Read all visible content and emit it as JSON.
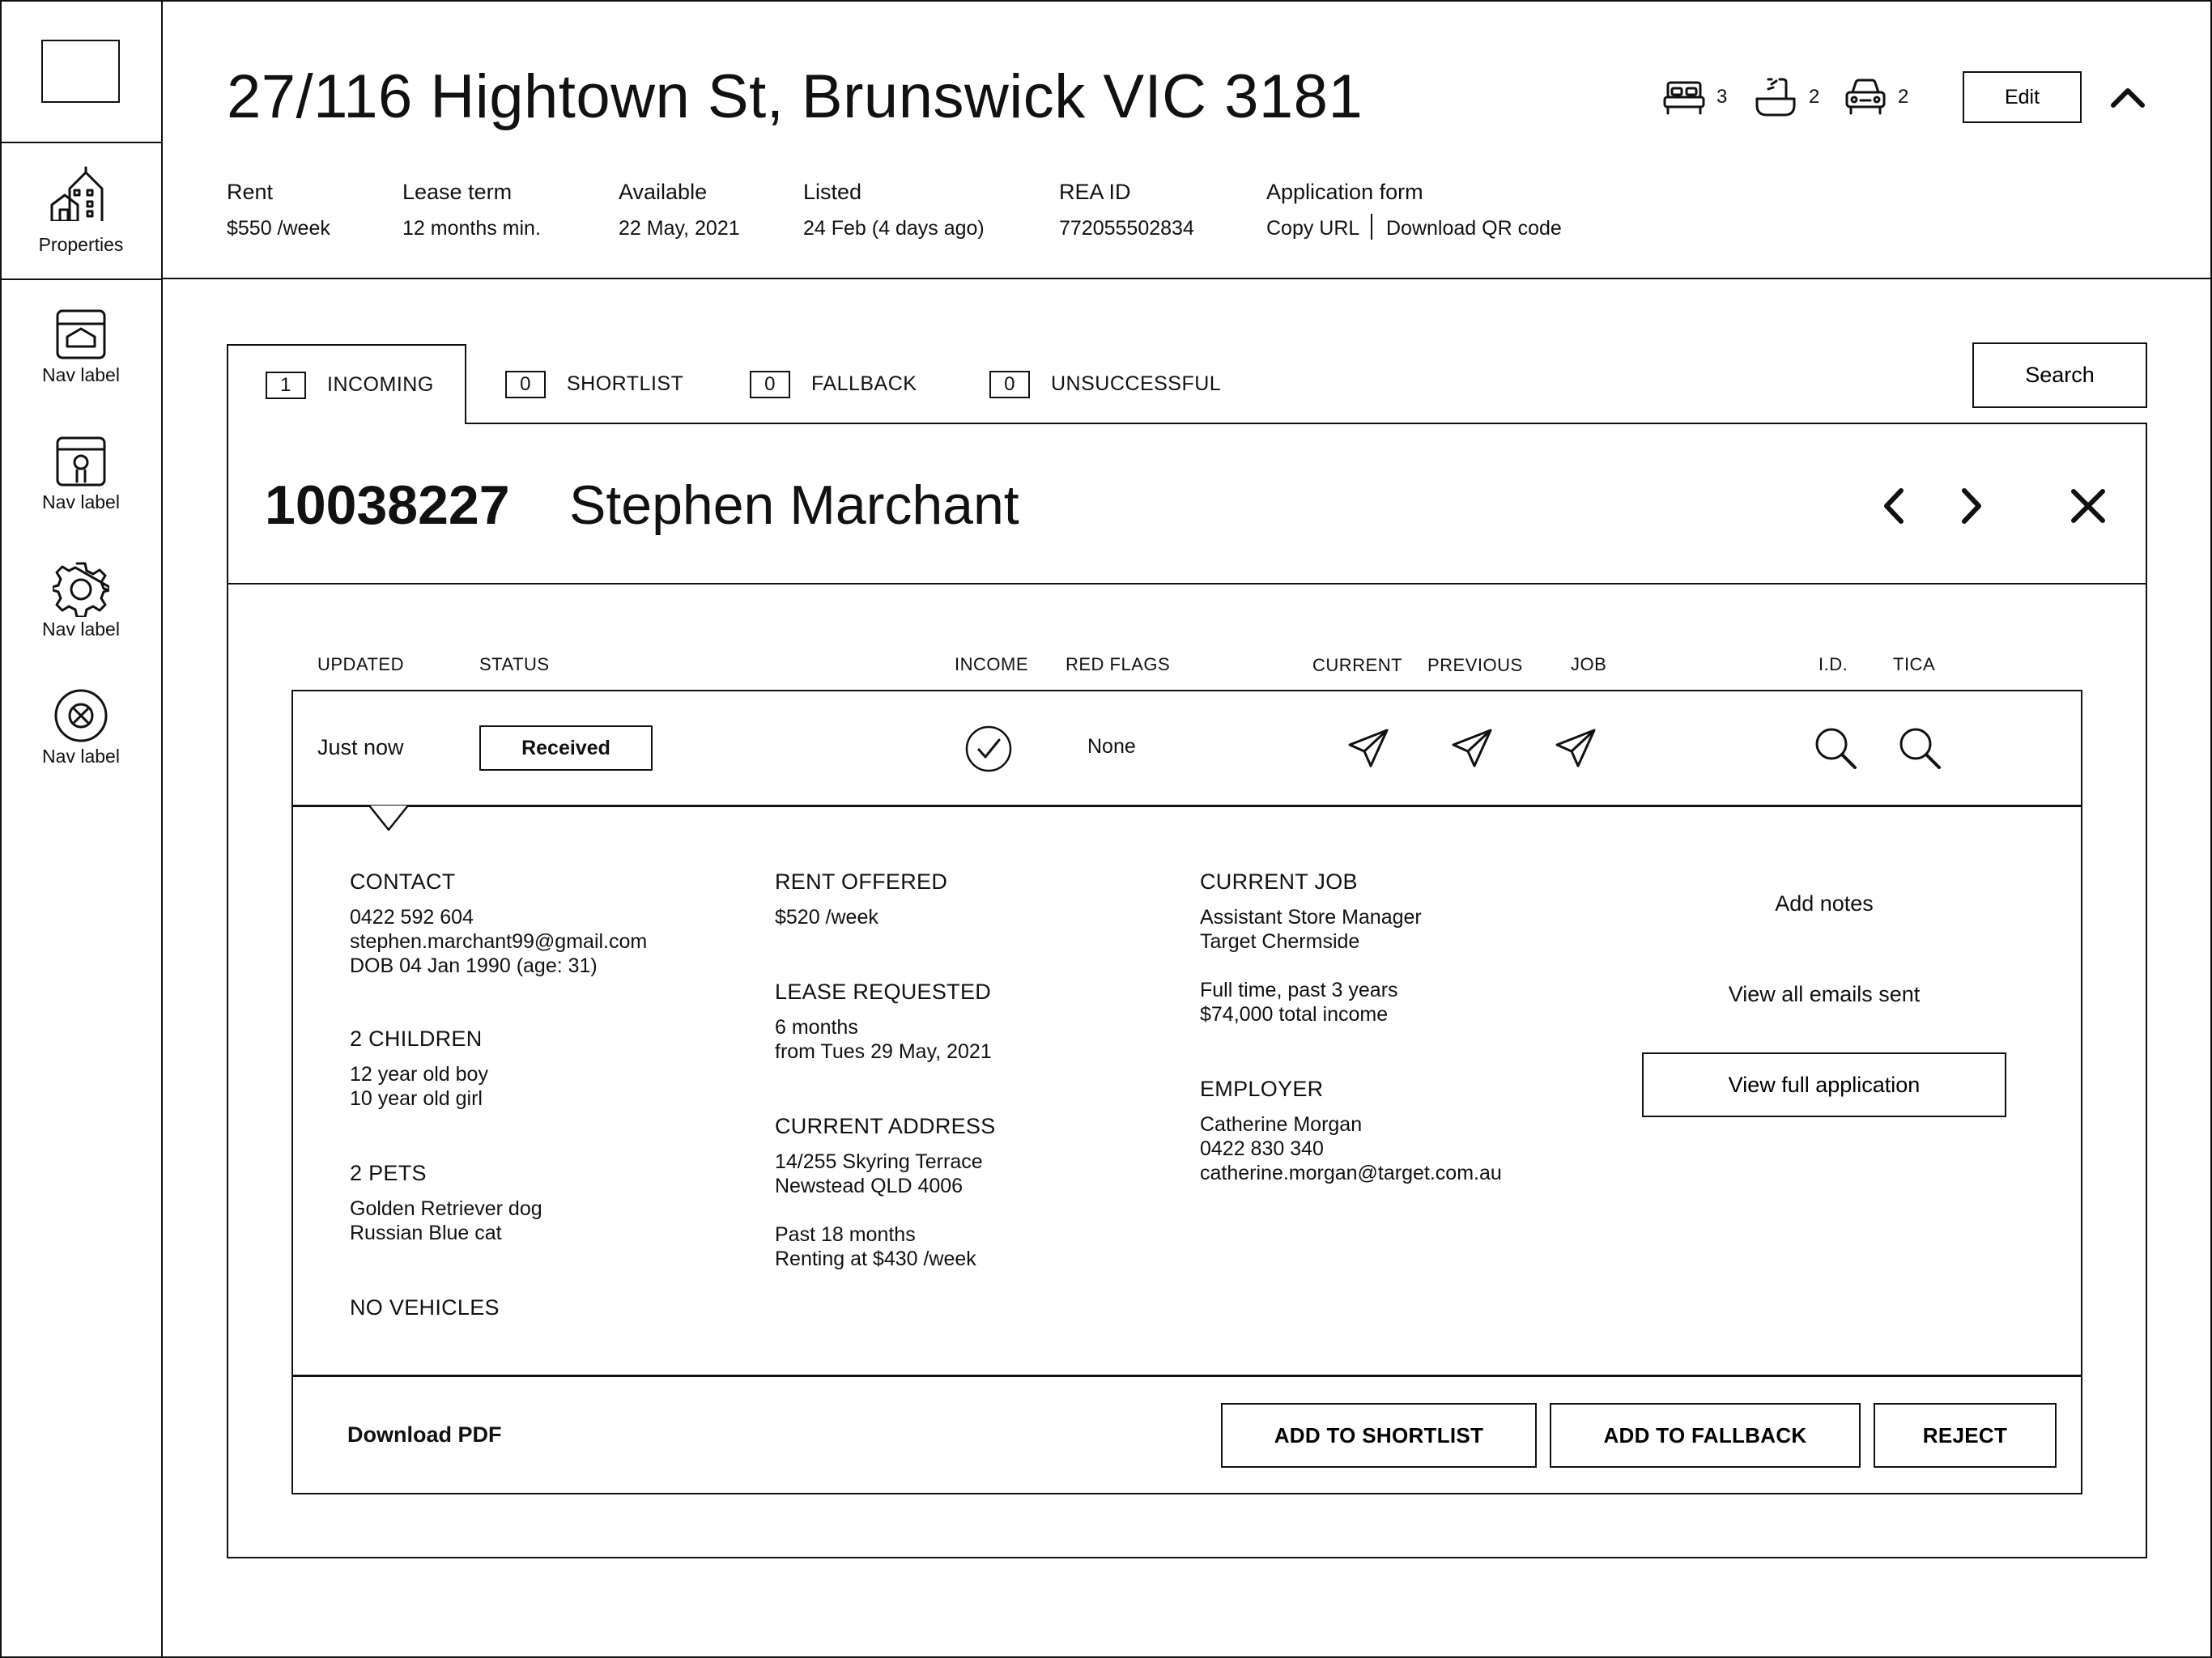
{
  "sidebar": {
    "properties_label": "Properties",
    "nav_items": [
      {
        "label": "Nav label",
        "icon": "inbox-icon"
      },
      {
        "label": "Nav label",
        "icon": "person-box-icon"
      },
      {
        "label": "Nav label",
        "icon": "gear-icon"
      },
      {
        "label": "Nav label",
        "icon": "close-circle-icon"
      }
    ]
  },
  "property": {
    "address": "27/116 Hightown St, Brunswick VIC 3181",
    "bedrooms": "3",
    "bathrooms": "2",
    "parking": "2",
    "edit_label": "Edit",
    "meta": {
      "rent_label": "Rent",
      "rent_value": "$550 /week",
      "lease_label": "Lease term",
      "lease_value": "12 months min.",
      "available_label": "Available",
      "available_value": "22 May, 2021",
      "listed_label": "Listed",
      "listed_value": "24 Feb (4 days ago)",
      "rea_label": "REA ID",
      "rea_value": "772055502834",
      "form_label": "Application form",
      "copy_url": "Copy URL",
      "download_qr": "Download QR code"
    }
  },
  "tabs": [
    {
      "count": "1",
      "label": "INCOMING"
    },
    {
      "count": "0",
      "label": "SHORTLIST"
    },
    {
      "count": "0",
      "label": "FALLBACK"
    },
    {
      "count": "0",
      "label": "UNSUCCESSFUL"
    }
  ],
  "search_label": "Search",
  "applicant": {
    "id": "10038227",
    "name": "Stephen Marchant"
  },
  "columns": {
    "updated": "UPDATED",
    "status": "STATUS",
    "income": "INCOME",
    "red_flags": "RED FLAGS",
    "current": "CURRENT",
    "previous": "PREVIOUS",
    "job": "JOB",
    "id": "I.D.",
    "tica": "TICA"
  },
  "row": {
    "updated": "Just now",
    "status": "Received",
    "red_flags": "None"
  },
  "details": {
    "contact_h": "CONTACT",
    "contact": [
      "0422 592 604",
      "stephen.marchant99@gmail.com",
      "DOB 04 Jan 1990 (age: 31)"
    ],
    "children_h": "2 CHILDREN",
    "children": [
      "12 year old boy",
      "10 year old girl"
    ],
    "pets_h": "2 PETS",
    "pets": [
      "Golden Retriever dog",
      "Russian Blue cat"
    ],
    "vehicles_h": "NO VEHICLES",
    "rent_offered_h": "RENT OFFERED",
    "rent_offered": "$520 /week",
    "lease_req_h": "LEASE REQUESTED",
    "lease_req": [
      "6 months",
      "from Tues 29 May, 2021"
    ],
    "current_addr_h": "CURRENT ADDRESS",
    "current_addr": [
      "14/255 Skyring Terrace",
      "Newstead QLD 4006"
    ],
    "current_addr_extra": [
      "Past 18 months",
      "Renting at $430 /week"
    ],
    "job_h": "CURRENT JOB",
    "job": [
      "Assistant Store Manager",
      "Target Chermside"
    ],
    "job_extra": [
      "Full time, past 3 years",
      "$74,000 total income"
    ],
    "employer_h": "EMPLOYER",
    "employer": [
      "Catherine Morgan",
      "0422 830 340",
      "catherine.morgan@target.com.au"
    ],
    "add_notes": "Add notes",
    "view_emails": "View all emails sent",
    "view_full": "View full application"
  },
  "footer": {
    "download_pdf": "Download PDF",
    "add_shortlist": "ADD TO SHORTLIST",
    "add_fallback": "ADD TO FALLBACK",
    "reject": "REJECT"
  }
}
